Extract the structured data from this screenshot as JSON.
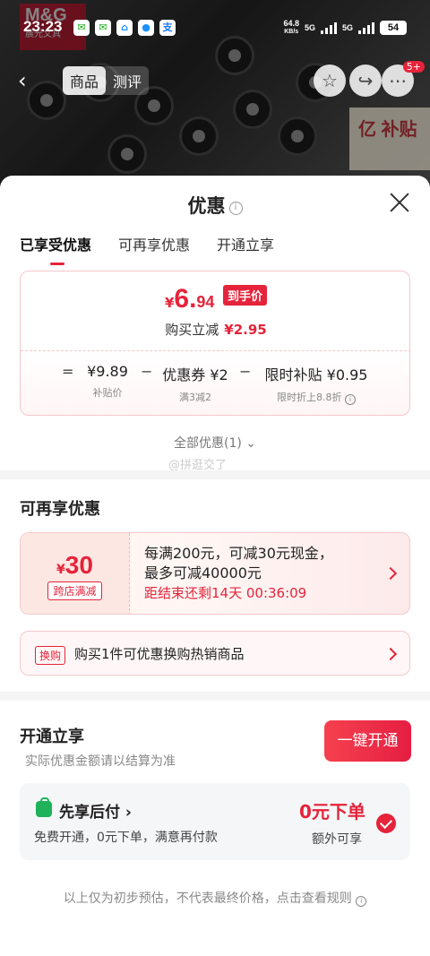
{
  "status_bar": {
    "time": "23:23",
    "app_icons": [
      "wechat-icon",
      "wechat-icon",
      "taobao-icon",
      "qq-icon",
      "alipay-icon"
    ],
    "net_speed_value": "64.8",
    "net_speed_unit": "KB/s",
    "network_1": "5G",
    "network_2": "5G",
    "battery": "54"
  },
  "background_page": {
    "brand_logo": "M&G",
    "brand_logo_sub": "晨光文具",
    "tabs": [
      "商品",
      "测评"
    ],
    "active_tab": "商品",
    "badge": "5+",
    "subsidy_banner": "亿 补贴"
  },
  "sheet": {
    "title": "优惠",
    "tabs": [
      "已享受优惠",
      "可再享优惠",
      "开通立享"
    ],
    "active_tab": "已享受优惠",
    "summary": {
      "currency": "¥",
      "price_int": "6.",
      "price_dec": "94",
      "price_tag": "到手价",
      "buy_reduce_label": "购买立减",
      "buy_reduce_value": "¥2.95",
      "eq": "=",
      "minus": "−",
      "base_price": "¥9.89",
      "base_label": "补贴价",
      "coupon": "优惠券 ¥2",
      "coupon_label": "满3减2",
      "subsidy": "限时补贴 ¥0.95",
      "subsidy_label": "限时折上8.8折"
    },
    "all_discounts": "全部优惠(1)",
    "watermark": "@拼逛交了",
    "more_section": {
      "title": "可再享优惠",
      "coupon_currency": "¥",
      "coupon_amount": "30",
      "coupon_label": "跨店满减",
      "line1": "每满200元，可减30元现金，",
      "line2": "最多可减40000元",
      "countdown": "距结束还剩14天 00:36:09",
      "exchange_tag": "换购",
      "exchange_text": "购买1件可优惠换购热销商品"
    },
    "open_section": {
      "title": "开通立享",
      "subtitle": "实际优惠金额请以结算为准",
      "button": "一键开通",
      "service_name": "先享后付",
      "service_desc": "免费开通，0元下单，满意再付款",
      "zero_order": "0元下单",
      "extra": "额外可享",
      "checked": true
    },
    "footer": "以上仅为初步预估，不代表最终价格，点击查看规则"
  },
  "colors": {
    "accent": "#e5233a",
    "green": "#20b25a"
  }
}
